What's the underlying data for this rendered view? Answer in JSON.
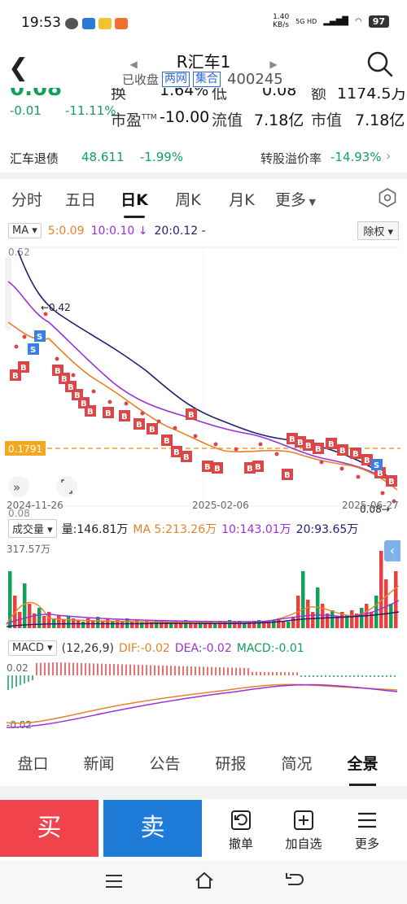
{
  "status_bar": {
    "time": "19:53",
    "network_speed": "1.40\nKB/s",
    "network": "5G HD",
    "battery": "97"
  },
  "header": {
    "title": "R汇车1",
    "closed_label": "已收盘",
    "tags": [
      "两网",
      "集合"
    ],
    "code": "400245"
  },
  "quote": {
    "price_partial": "0.08",
    "change": "-0.01",
    "change_pct": "-11.11%",
    "turnover_label": "换",
    "turnover_value": "1.64%",
    "low_label": "低",
    "low_value": "0.08",
    "amount_label": "额",
    "amount_value": "1174.5万",
    "pe_label": "市盈",
    "pe_sup": "TTM",
    "pe_value": "-10.00",
    "float_label": "流值",
    "float_value": "7.18亿",
    "mcap_label": "市值",
    "mcap_value": "7.18亿"
  },
  "bond": {
    "name": "汇车退债",
    "price": "48.611",
    "change_pct": "-1.99%",
    "premium_label": "转股溢价率",
    "premium_value": "-14.93%"
  },
  "period_tabs": [
    "分时",
    "五日",
    "日K",
    "周K",
    "月K",
    "更多"
  ],
  "active_period": "日K",
  "kline": {
    "ma_selector": "MA",
    "ma5": "5:0.09",
    "ma10": "10:0.10 ↓",
    "ma20": "20:0.12 -",
    "adjust": "除权",
    "high_label": "0.52",
    "low_label": "0.08",
    "marker_high": "←0.42",
    "marker_low": "0.08→",
    "current_price_line": "0.1791",
    "dates": [
      "2024-11-26",
      "2025-02-06",
      "2025-06-27"
    ]
  },
  "volume": {
    "selector": "成交量",
    "vol": "量:146.81万",
    "ma_label": "MA",
    "ma5": "5:213.26万",
    "ma10": "10:143.01万",
    "ma20": "20:93.65万",
    "max_label": "317.57万"
  },
  "macd": {
    "selector": "MACD",
    "params": "(12,26,9)",
    "dif": "DIF:-0.02",
    "dea": "DEA:-0.02",
    "macd": "MACD:-0.01",
    "top_label": "0.02",
    "bottom_label": "-0.02"
  },
  "bottom_tabs": [
    "盘口",
    "新闻",
    "公告",
    "研报",
    "简况",
    "全景"
  ],
  "active_bottom_tab": "全景",
  "actions": {
    "buy": "买",
    "sell": "卖",
    "revoke": "撤单",
    "add_watch": "加自选",
    "more": "更多"
  },
  "colors": {
    "up": "#e8413f",
    "down": "#12a05c",
    "ma5": "#e8822a",
    "ma10": "#9b30d6",
    "ma20": "#1f1f6e",
    "accent_blue": "#2f6bd6"
  }
}
